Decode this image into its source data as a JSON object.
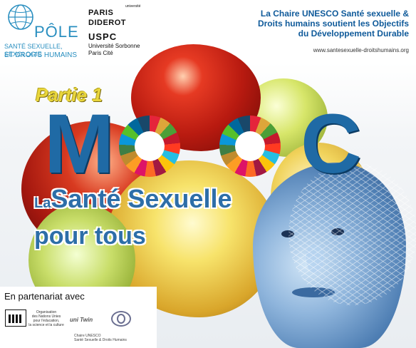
{
  "header": {
    "pole": {
      "name": "PÔLE",
      "subtitle_line1": "SANTÉ SEXUELLE, SEXOLOGIE",
      "subtitle_line2": "ET DROITS HUMAINS",
      "icon": "globe-icon"
    },
    "university": {
      "small_label": "université",
      "line1": "PARIS",
      "line2": "DIDEROT",
      "uspc": "USPC",
      "uspc_line1": "Université Sorbonne",
      "uspc_line2": "Paris Cité"
    },
    "chaire": {
      "line1": "La Chaire UNESCO Santé sexuelle &",
      "line2": "Droits humains soutient les Objectifs",
      "line3": "du Développement Durable",
      "url": "www.santesexuelle-droitshumains.org"
    }
  },
  "title": {
    "partie": "Partie 1",
    "mooc_m": "M",
    "mooc_c": "C",
    "la": "La",
    "line1": "Santé Sexuelle",
    "line2": "pour tous"
  },
  "partners": {
    "heading": "En partenariat avec",
    "unesco_text_1": "Organisation",
    "unesco_text_2": "des Nations Unies",
    "unesco_text_3": "pour l'éducation,",
    "unesco_text_4": "la science et la culture",
    "unitwin_label": "uni Twin",
    "unitwin_line1": "Chaire UNESCO",
    "unitwin_line2": "Santé Sexuelle & Droits Humains"
  },
  "colors": {
    "brand_blue": "#1f6aa5",
    "chaire_blue": "#0f5a9a",
    "partie_yellow": "#e9d63c"
  }
}
